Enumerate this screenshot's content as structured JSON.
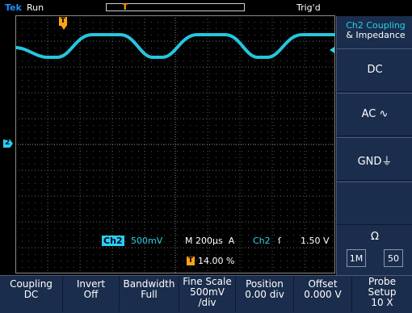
{
  "top_bar": {
    "brand": "Tek",
    "status": "Run",
    "trigger_status": "Trig'd"
  },
  "screen": {
    "channel_marker": "2",
    "trigger_marker": "T",
    "readout": {
      "channel_badge": "Ch2",
      "channel_scale": "500mV",
      "timebase": "M 200µs",
      "trigger_mode": "A",
      "trigger_source": "Ch2",
      "trigger_slope_symbol": "ſ",
      "trigger_level": "1.50 V",
      "position_marker": "T",
      "horizontal_position": "14.00 %"
    }
  },
  "sidebar": {
    "title_line1": "Ch2 Coupling",
    "title_line2": "& Impedance",
    "buttons": [
      {
        "label": "DC"
      },
      {
        "label": "AC ∿"
      },
      {
        "label": "GND⏚"
      }
    ],
    "impedance_symbol": "Ω",
    "impedance_options": [
      "1M",
      "50"
    ]
  },
  "bottom_menu": [
    {
      "line1": "Coupling",
      "line2": "DC"
    },
    {
      "line1": "Invert",
      "line2": "Off"
    },
    {
      "line1": "Bandwidth",
      "line2": "Full"
    },
    {
      "line1": "Fine Scale",
      "line2": "500mV",
      "line3": "/div"
    },
    {
      "line1": "Position",
      "line2": "0.00 div"
    },
    {
      "line1": "Offset",
      "line2": "0.000 V"
    },
    {
      "line1": "Probe",
      "line2": "Setup",
      "line3": "10 X"
    }
  ],
  "colors": {
    "channel": "#27d1ea",
    "trigger": "#ffa21a",
    "menu_bg": "#1a2d4c",
    "screen_bg": "#000000"
  }
}
